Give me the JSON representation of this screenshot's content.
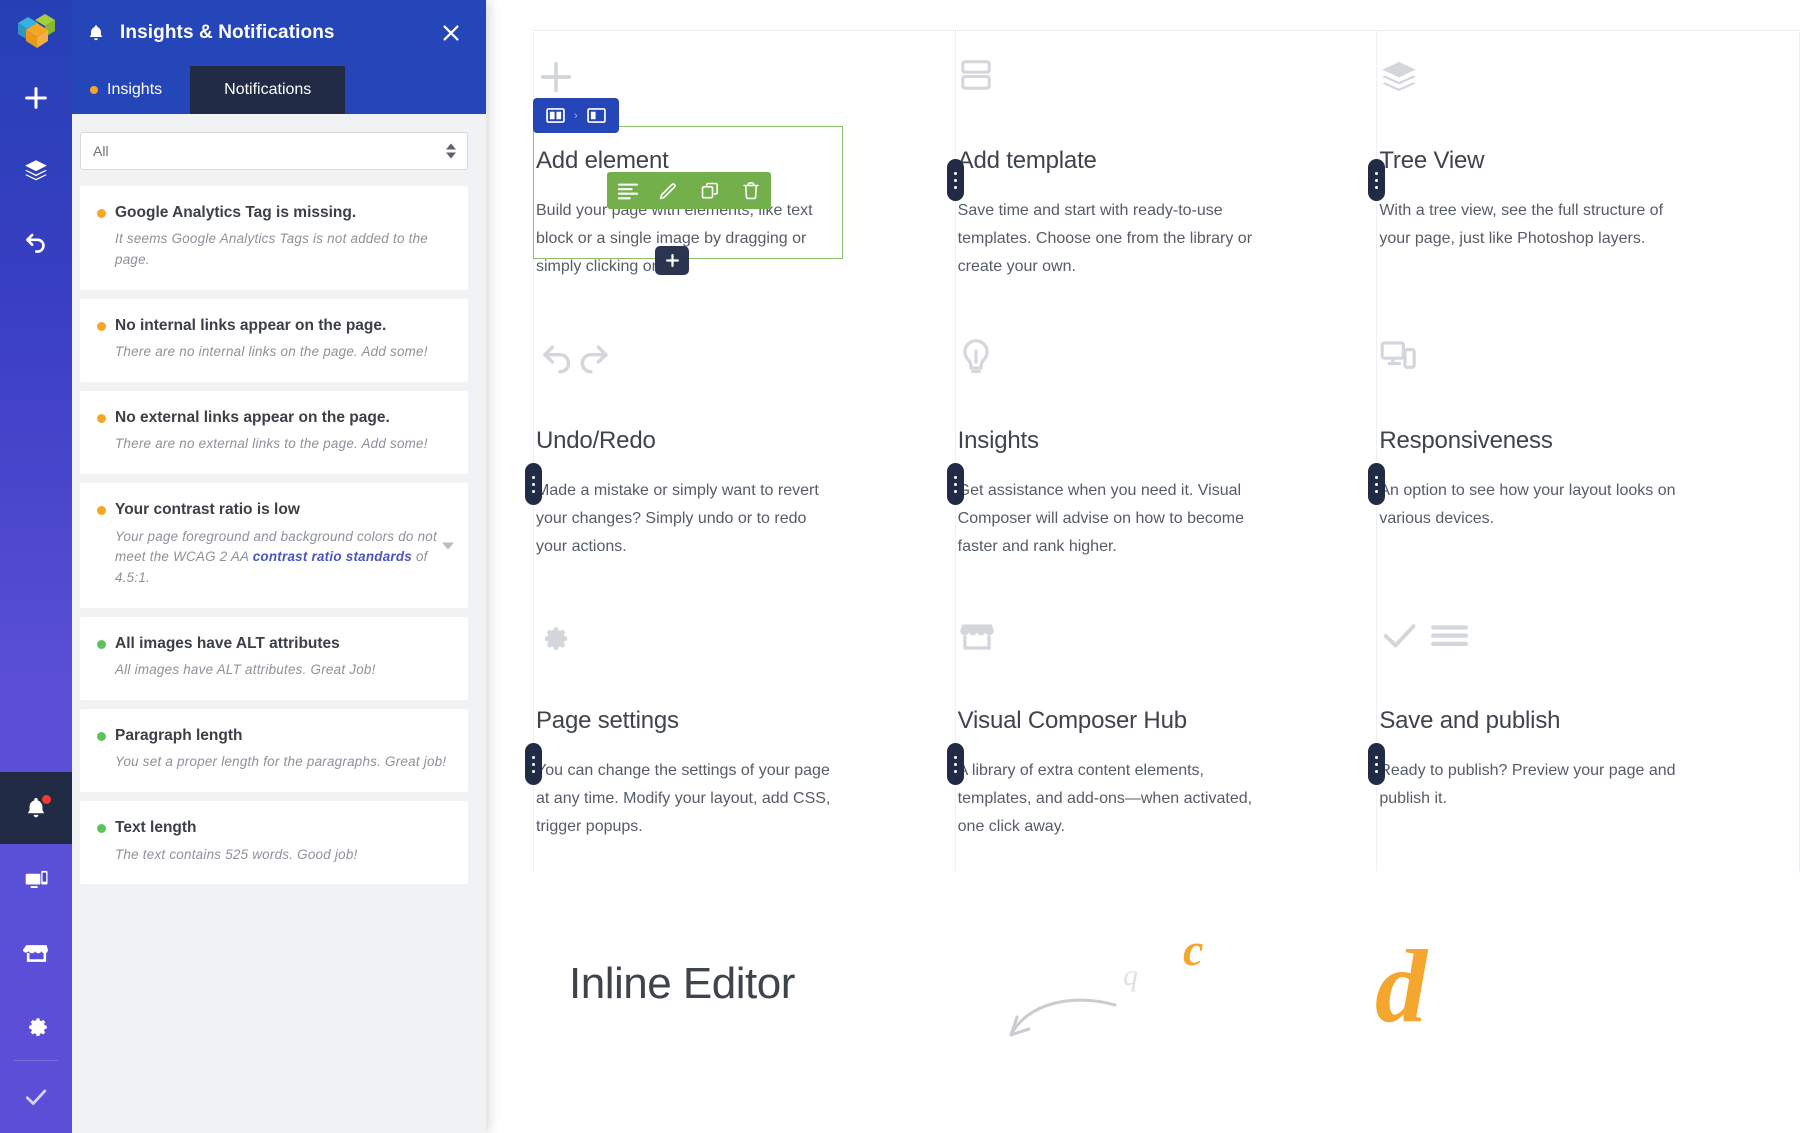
{
  "app": {
    "logo_icon": "visual-composer-cubes-logo"
  },
  "rail": {
    "items": [
      {
        "id": "add",
        "icon": "plus-icon",
        "label": "Add element"
      },
      {
        "id": "templates",
        "icon": "layers-icon",
        "label": "Templates"
      },
      {
        "id": "undo",
        "icon": "undo-arrow-icon",
        "label": "Undo"
      }
    ],
    "bottom_items": [
      {
        "id": "notifications",
        "icon": "bell-icon",
        "label": "Insights & Notifications",
        "active": true,
        "badge": true
      },
      {
        "id": "responsive",
        "icon": "devices-icon",
        "label": "Responsiveness"
      },
      {
        "id": "hub",
        "icon": "hub-shop-icon",
        "label": "Visual Composer Hub"
      },
      {
        "id": "settings",
        "icon": "gear-icon",
        "label": "Page settings"
      },
      {
        "id": "publish",
        "icon": "check-icon",
        "label": "Save and publish"
      }
    ]
  },
  "panel": {
    "title": "Insights & Notifications",
    "bell_icon": "bell-icon",
    "close_icon": "close-icon",
    "tabs": [
      {
        "id": "insights",
        "label": "Insights",
        "active": true,
        "dot_color": "#f5a623"
      },
      {
        "id": "notifications",
        "label": "Notifications",
        "active": false
      }
    ],
    "filter": {
      "value": "All",
      "placeholder": "All",
      "options": [
        "All"
      ],
      "icon": "stepper-arrows-icon"
    },
    "colors": {
      "warning": "#f5a623",
      "success": "#5cc35c",
      "header_blue": "#2546b8",
      "tab_dark": "#222b45",
      "link": "#4a54c4"
    },
    "insights": [
      {
        "severity": "warning",
        "title": "Google Analytics Tag is missing.",
        "desc_before": "It seems Google Analytics Tags is not added to the page.",
        "link_text": "",
        "desc_after": "",
        "chevron": false
      },
      {
        "severity": "warning",
        "title": "No internal links appear on the page.",
        "desc_before": "There are no internal links on the page. Add some!",
        "link_text": "",
        "desc_after": "",
        "chevron": false
      },
      {
        "severity": "warning",
        "title": "No external links appear on the page.",
        "desc_before": "There are no external links to the page. Add some!",
        "link_text": "",
        "desc_after": "",
        "chevron": false
      },
      {
        "severity": "warning",
        "title": "Your contrast ratio is low",
        "desc_before": "Your page foreground and background colors do not meet the WCAG 2 AA ",
        "link_text": "contrast ratio standards",
        "desc_after": " of 4.5:1.",
        "chevron": true
      },
      {
        "severity": "success",
        "title": "All images have ALT attributes",
        "desc_before": "All images have ALT attributes. Great Job!",
        "link_text": "",
        "desc_after": "",
        "chevron": false
      },
      {
        "severity": "success",
        "title": "Paragraph length",
        "desc_before": "You set a proper length for the paragraphs. Great job!",
        "link_text": "",
        "desc_after": "",
        "chevron": false
      },
      {
        "severity": "success",
        "title": "Text length",
        "desc_before": "The text contains 525 words. Good job!",
        "link_text": "",
        "desc_after": "",
        "chevron": false
      }
    ]
  },
  "canvas": {
    "features": [
      {
        "icon": "plus-icon",
        "title": "Add element",
        "body": "Build your page with elements, like text block or a single image by dragging or simply clicking on it."
      },
      {
        "icon": "template-layout-icon",
        "title": "Add template",
        "body": "Save time and start with ready-to-use templates. Choose one from the library or create your own."
      },
      {
        "icon": "stacked-layers-icon",
        "title": "Tree View",
        "body": "With a tree view, see the full structure of your page, just like Photoshop layers."
      },
      {
        "icon": "undo-redo-arrows-icon",
        "title": "Undo/Redo",
        "body": "Made a mistake or simply want to revert your changes? Simply undo or to redo your actions."
      },
      {
        "icon": "lightbulb-icon",
        "title": "Insights",
        "body": "Get assistance when you need it. Visual Composer will advise on how to become faster and rank higher."
      },
      {
        "icon": "responsive-devices-icon",
        "title": "Responsiveness",
        "body": "An option to see how your layout looks on various devices."
      },
      {
        "icon": "gear-icon",
        "title": "Page settings",
        "body": "You can change the settings of your page at any time. Modify your layout, add CSS, trigger popups."
      },
      {
        "icon": "hub-shop-icon",
        "title": "Visual Composer Hub",
        "body": "A library of extra content elements, templates, and add-ons—when activated, one click away."
      },
      {
        "icon": "check-lines-icon",
        "title": "Save and publish",
        "body": "Ready to publish? Preview your page and publish it."
      }
    ],
    "selection": {
      "breadcrumb": [
        {
          "icon": "row-columns-icon"
        },
        {
          "icon": "column-icon"
        }
      ],
      "separator": "›",
      "border_color": "#8cbf6a",
      "breadcrumb_color": "#2546b8",
      "toolbar_color": "#73b04b",
      "toolbar_buttons": [
        {
          "icon": "align-text-icon",
          "label": "Edit content"
        },
        {
          "icon": "pencil-edit-icon",
          "label": "Edit"
        },
        {
          "icon": "copy-duplicate-icon",
          "label": "Duplicate"
        },
        {
          "icon": "trash-delete-icon",
          "label": "Delete"
        }
      ],
      "add_chip_icon": "plus-icon"
    },
    "hero": {
      "title": "Inline Editor",
      "decorations": [
        {
          "glyph": "c",
          "color": "#f5a62e"
        },
        {
          "glyph": "q",
          "color": "#dfe1e4"
        },
        {
          "glyph": "d",
          "color": "#f5a62e"
        },
        {
          "glyph": "curved-arrow-icon",
          "color": "#c9ccd1"
        }
      ]
    }
  }
}
